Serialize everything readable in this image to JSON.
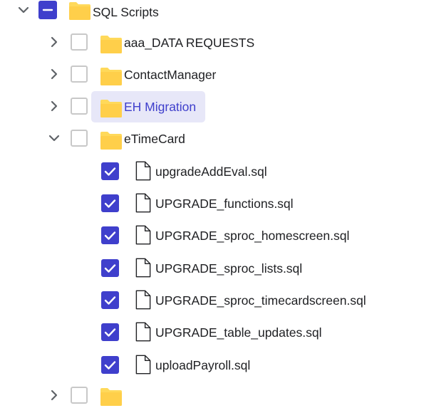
{
  "tree": {
    "root": {
      "label": "SQL Scripts",
      "expanded": true,
      "check_state": "indeterminate"
    },
    "folders": [
      {
        "label": "aaa_DATA REQUESTS",
        "expanded": false,
        "checked": false,
        "selected": false
      },
      {
        "label": "ContactManager",
        "expanded": false,
        "checked": false,
        "selected": false
      },
      {
        "label": "EH Migration",
        "expanded": false,
        "checked": false,
        "selected": true
      },
      {
        "label": "eTimeCard",
        "expanded": true,
        "checked": false,
        "selected": false
      }
    ],
    "etimecard_files": [
      {
        "label": "upgradeAddEval.sql",
        "checked": true
      },
      {
        "label": "UPGRADE_functions.sql",
        "checked": true
      },
      {
        "label": "UPGRADE_sproc_homescreen.sql",
        "checked": true
      },
      {
        "label": "UPGRADE_sproc_lists.sql",
        "checked": true
      },
      {
        "label": "UPGRADE_sproc_timecardscreen.sql",
        "checked": true
      },
      {
        "label": "UPGRADE_table_updates.sql",
        "checked": true
      },
      {
        "label": "uploadPayroll.sql",
        "checked": true
      }
    ]
  },
  "colors": {
    "accent": "#3f3fcc",
    "selection_bg": "#e7e7f8",
    "folder": "#ffcf4a",
    "folder_tab": "#ffd95a",
    "checkbox_border": "#c8c8c8"
  },
  "icons": {
    "expand": "chevron-right-icon",
    "collapse": "chevron-down-icon",
    "folder": "folder-icon",
    "file": "file-icon",
    "checkmark": "checkmark-icon",
    "partial": "minus-icon"
  }
}
